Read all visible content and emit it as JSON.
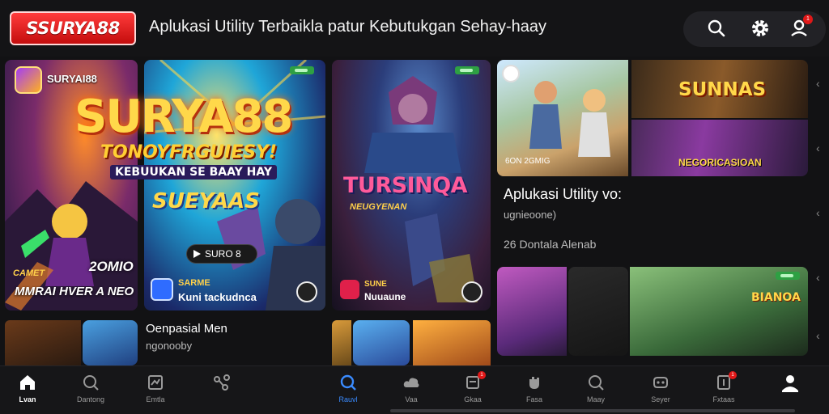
{
  "header": {
    "logo_text": "SSURYA88",
    "title": "Aplukasi Utility Terbaikla patur Kebutukgan Sehay-haay",
    "notification_count": "1"
  },
  "featured": {
    "card1": {
      "name": "SURYAI88",
      "number": "2OMIO",
      "footer_small": "CAMET",
      "footer_big": "MMRAI HVER A NEO"
    },
    "card2": {
      "brand": "SURYA88",
      "tagline": "TONOYFRGUIESY!",
      "subtitle": "KEBUUKAN SE BAAY HAY",
      "game": "SUEYAAS",
      "pill": "SURO 8",
      "footer_small": "SARME",
      "footer_big": "Kuni tackudnca"
    },
    "card3": {
      "title": "TURSINQA",
      "subtitle": "NEUGYENAN",
      "footer_small": "SUNE",
      "footer_big": "Nuuaune"
    }
  },
  "right_panel": {
    "banner_top": "SUNNAS",
    "banner_bottom": "NEGORICASIOAN",
    "thumb_caption": "6ON 2GMIG",
    "title": "Aplukasi Utility vo:",
    "subtitle": "ugnieoone)",
    "meta": "26 Dontala Alenab",
    "bottom_banner": "BIANOA"
  },
  "bottom_row": {
    "title": "Oenpasial Men",
    "subtitle": "ngonooby"
  },
  "nav": [
    {
      "label": "Lvan",
      "icon": "home-icon",
      "state": "active"
    },
    {
      "label": "Dantong",
      "icon": "search-icon",
      "state": ""
    },
    {
      "label": "Emtla",
      "icon": "chart-icon",
      "state": ""
    },
    {
      "label": "",
      "icon": "share-icon",
      "state": ""
    },
    {
      "label": "Rauvl",
      "icon": "search-icon",
      "state": "active-blue"
    },
    {
      "label": "Vaa",
      "icon": "cloud-icon",
      "state": ""
    },
    {
      "label": "Gkaa",
      "icon": "app-icon",
      "state": "",
      "badge": "1"
    },
    {
      "label": "Fasa",
      "icon": "hand-icon",
      "state": ""
    },
    {
      "label": "Maay",
      "icon": "search-icon",
      "state": ""
    },
    {
      "label": "Seyer",
      "icon": "game-icon",
      "state": ""
    },
    {
      "label": "Fxtaas",
      "icon": "news-icon",
      "state": "",
      "badge": "1"
    },
    {
      "label": "",
      "icon": "profile-icon",
      "state": "active"
    }
  ]
}
